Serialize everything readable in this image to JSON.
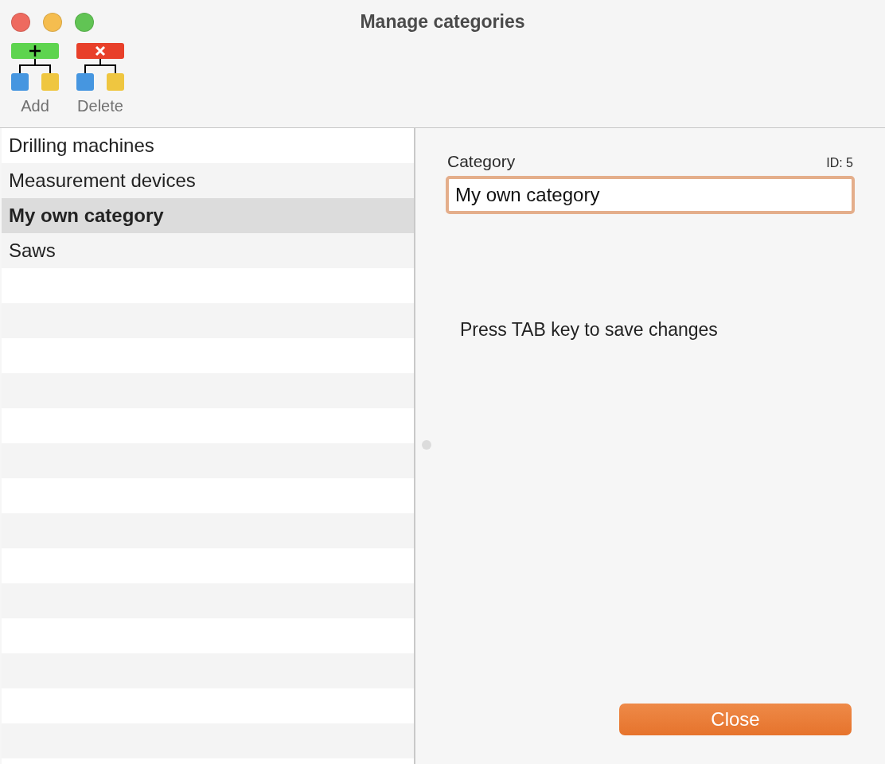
{
  "window": {
    "title": "Manage categories"
  },
  "toolbar": [
    {
      "kind": "add",
      "label": "Add"
    },
    {
      "kind": "delete",
      "label": "Delete"
    }
  ],
  "categories": [
    {
      "name": "Drilling machines",
      "selected": false
    },
    {
      "name": "Measurement devices",
      "selected": false
    },
    {
      "name": "My own category",
      "selected": true
    },
    {
      "name": "Saws",
      "selected": false
    }
  ],
  "detail": {
    "label": "Category",
    "id": "ID: 5",
    "value": "My own category",
    "focused": true,
    "hint": "Press TAB key to save changes"
  },
  "buttons": [
    {
      "label": "Close"
    }
  ]
}
